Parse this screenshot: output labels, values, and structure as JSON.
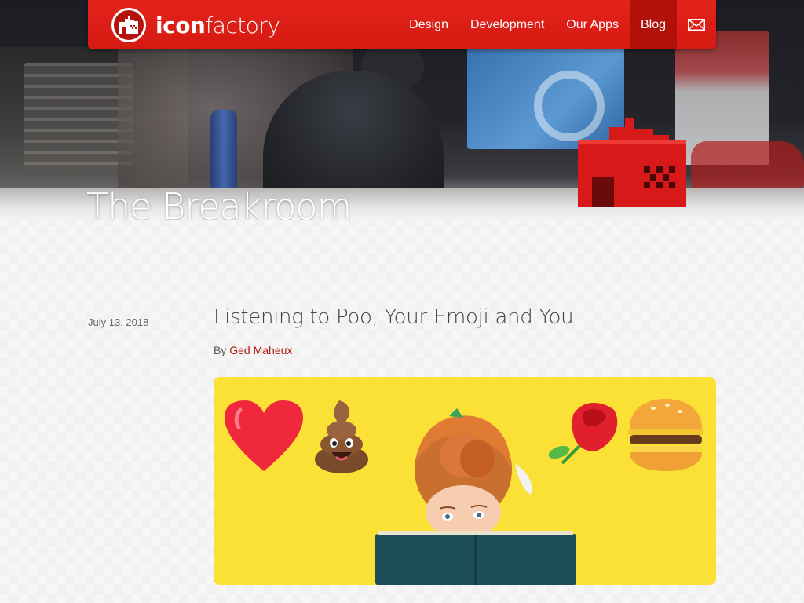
{
  "brand": {
    "name_bold": "icon",
    "name_light": "factory"
  },
  "nav": {
    "items": [
      {
        "label": "Design"
      },
      {
        "label": "Development"
      },
      {
        "label": "Our Apps"
      },
      {
        "label": "Blog",
        "active": true
      }
    ],
    "mail_icon": "envelope-icon"
  },
  "hero": {
    "title": "The Breakroom"
  },
  "post": {
    "date": "July 13, 2018",
    "title": "Listening to Poo, Your Emoji and You",
    "by_label": "By",
    "author": "Ged Maheux",
    "image_icons": [
      "heart-emoji",
      "poo-emoji",
      "rose-emoji",
      "burger-emoji"
    ]
  },
  "colors": {
    "brand_red": "#d51a12",
    "active_tab": "#b21109",
    "author_link": "#b0190f",
    "feature_bg": "#fbe036"
  }
}
